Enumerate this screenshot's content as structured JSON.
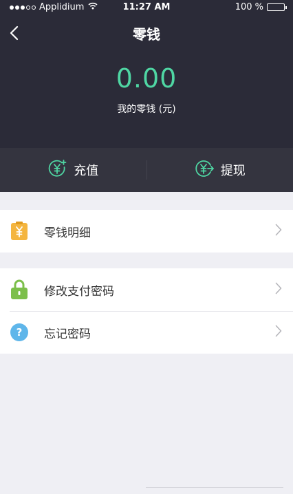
{
  "status_bar": {
    "carrier": "Applidium",
    "time": "11:27 AM",
    "battery": "100 %",
    "signal_icon": "signal-dots-icon",
    "wifi_icon": "wifi-icon",
    "battery_icon": "battery-icon"
  },
  "nav": {
    "title": "零钱",
    "back_icon": "back-chevron-icon"
  },
  "wallet": {
    "balance": "0.00",
    "balance_label": "我的零钱 (元)",
    "balance_color": "#4fd6a3"
  },
  "actions": [
    {
      "label": "充值",
      "icon": "yuan-plus-icon"
    },
    {
      "label": "提现",
      "icon": "yuan-withdraw-icon"
    }
  ],
  "menu": {
    "details": {
      "label": "零钱明细",
      "icon": "yuan-clipboard-icon"
    },
    "change_password": {
      "label": "修改支付密码",
      "icon": "lock-icon"
    },
    "forgot_password": {
      "label": "忘记密码",
      "icon": "question-icon"
    }
  },
  "colors": {
    "header_bg": "#2b2b38",
    "action_bar_bg": "#34343f",
    "accent": "#4fd6a3",
    "page_bg": "#efeff4"
  }
}
